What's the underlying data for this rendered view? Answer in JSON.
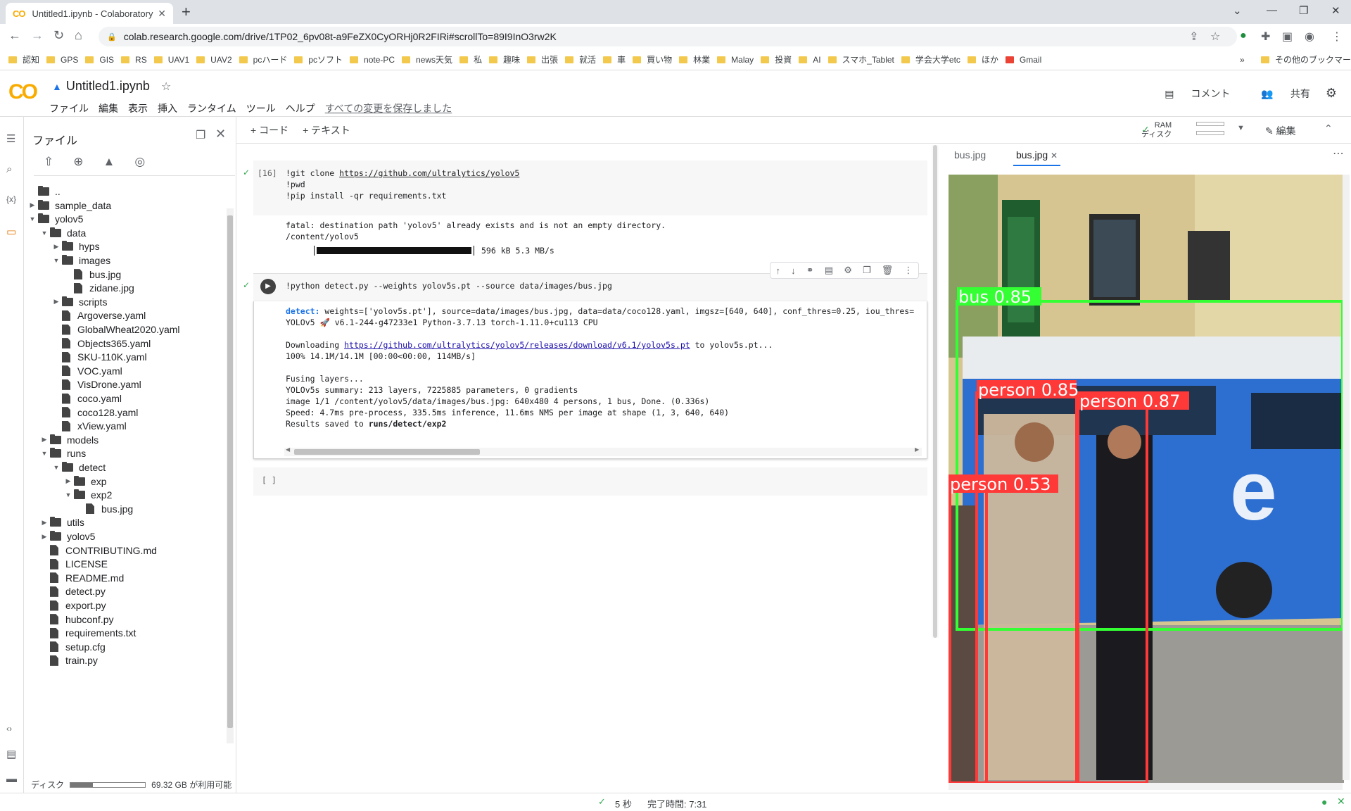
{
  "browser": {
    "tab_title": "Untitled1.ipynb - Colaboratory",
    "tab_favicon": "CO",
    "new_tab": "+",
    "url": "colab.research.google.com/drive/1TP02_6pv08t-a9FeZX0CyORHj0R2FIRi#scrollTo=89I9InO3rw2K",
    "bookmarks": [
      "認知",
      "GPS",
      "GIS",
      "RS",
      "UAV1",
      "UAV2",
      "pcハード",
      "pcソフト",
      "note-PC",
      "news天気",
      "私",
      "趣味",
      "出張",
      "就活",
      "車",
      "買い物",
      "林業",
      "Malay",
      "投資",
      "AI",
      "スマホ_Tablet",
      "学会大学etc",
      "ほか",
      "Gmail"
    ],
    "bookmarks_more": "»",
    "other_bookmarks": "その他のブックマーク"
  },
  "colab": {
    "logo": "CO",
    "title": "Untitled1.ipynb",
    "menus": [
      "ファイル",
      "編集",
      "表示",
      "挿入",
      "ランタイム",
      "ツール",
      "ヘルプ"
    ],
    "saved_status": "すべての変更を保存しました",
    "comment": "コメント",
    "share": "共有"
  },
  "files_panel": {
    "title": "ファイル",
    "tree": [
      {
        "name": "..",
        "depth": 0,
        "kind": "up",
        "arrow": ""
      },
      {
        "name": "sample_data",
        "depth": 0,
        "kind": "folder",
        "arrow": "▶"
      },
      {
        "name": "yolov5",
        "depth": 0,
        "kind": "folder",
        "arrow": "▼"
      },
      {
        "name": "data",
        "depth": 1,
        "kind": "folder",
        "arrow": "▼"
      },
      {
        "name": "hyps",
        "depth": 2,
        "kind": "folder",
        "arrow": "▶"
      },
      {
        "name": "images",
        "depth": 2,
        "kind": "folder",
        "arrow": "▼"
      },
      {
        "name": "bus.jpg",
        "depth": 3,
        "kind": "file",
        "arrow": ""
      },
      {
        "name": "zidane.jpg",
        "depth": 3,
        "kind": "file",
        "arrow": ""
      },
      {
        "name": "scripts",
        "depth": 2,
        "kind": "folder",
        "arrow": "▶"
      },
      {
        "name": "Argoverse.yaml",
        "depth": 2,
        "kind": "file",
        "arrow": ""
      },
      {
        "name": "GlobalWheat2020.yaml",
        "depth": 2,
        "kind": "file",
        "arrow": ""
      },
      {
        "name": "Objects365.yaml",
        "depth": 2,
        "kind": "file",
        "arrow": ""
      },
      {
        "name": "SKU-110K.yaml",
        "depth": 2,
        "kind": "file",
        "arrow": ""
      },
      {
        "name": "VOC.yaml",
        "depth": 2,
        "kind": "file",
        "arrow": ""
      },
      {
        "name": "VisDrone.yaml",
        "depth": 2,
        "kind": "file",
        "arrow": ""
      },
      {
        "name": "coco.yaml",
        "depth": 2,
        "kind": "file",
        "arrow": ""
      },
      {
        "name": "coco128.yaml",
        "depth": 2,
        "kind": "file",
        "arrow": ""
      },
      {
        "name": "xView.yaml",
        "depth": 2,
        "kind": "file",
        "arrow": ""
      },
      {
        "name": "models",
        "depth": 1,
        "kind": "folder",
        "arrow": "▶"
      },
      {
        "name": "runs",
        "depth": 1,
        "kind": "folder",
        "arrow": "▼"
      },
      {
        "name": "detect",
        "depth": 2,
        "kind": "folder",
        "arrow": "▼"
      },
      {
        "name": "exp",
        "depth": 3,
        "kind": "folder",
        "arrow": "▶"
      },
      {
        "name": "exp2",
        "depth": 3,
        "kind": "folder",
        "arrow": "▼"
      },
      {
        "name": "bus.jpg",
        "depth": 4,
        "kind": "file",
        "arrow": ""
      },
      {
        "name": "utils",
        "depth": 1,
        "kind": "folder",
        "arrow": "▶"
      },
      {
        "name": "yolov5",
        "depth": 1,
        "kind": "folder",
        "arrow": "▶"
      },
      {
        "name": "CONTRIBUTING.md",
        "depth": 1,
        "kind": "file",
        "arrow": ""
      },
      {
        "name": "LICENSE",
        "depth": 1,
        "kind": "file",
        "arrow": ""
      },
      {
        "name": "README.md",
        "depth": 1,
        "kind": "file",
        "arrow": ""
      },
      {
        "name": "detect.py",
        "depth": 1,
        "kind": "file",
        "arrow": ""
      },
      {
        "name": "export.py",
        "depth": 1,
        "kind": "file",
        "arrow": ""
      },
      {
        "name": "hubconf.py",
        "depth": 1,
        "kind": "file",
        "arrow": ""
      },
      {
        "name": "requirements.txt",
        "depth": 1,
        "kind": "file",
        "arrow": ""
      },
      {
        "name": "setup.cfg",
        "depth": 1,
        "kind": "file",
        "arrow": ""
      },
      {
        "name": "train.py",
        "depth": 1,
        "kind": "file",
        "arrow": ""
      }
    ],
    "disk_label": "ディスク",
    "disk_free": "69.32 GB が利用可能",
    "disk_used_fraction": 0.3
  },
  "toolbar": {
    "add_code": "+ コード",
    "add_text": "+ テキスト",
    "ram": "RAM",
    "disk": "ディスク",
    "edit": "編集"
  },
  "cells": {
    "cell1": {
      "exec_count": "[16]",
      "code_line1_prefix": "!git clone ",
      "code_line1_link": "https://github.com/ultralytics/yolov5",
      "code_line2": "!pwd",
      "code_line3": "!pip install -qr requirements.txt",
      "out_line1": "fatal: destination path 'yolov5' already exists and is not an empty directory.",
      "out_line2": "/content/yolov5",
      "progress": "596 kB 5.3 MB/s"
    },
    "cell2": {
      "code": "!python detect.py --weights yolov5s.pt --source data/images/bus.jpg",
      "detect_label": "detect: ",
      "detect_args": "weights=['yolov5s.pt'], source=data/images/bus.jpg, data=data/coco128.yaml, imgsz=[640, 640], conf_thres=0.25, iou_thres=",
      "version_prefix": "YOLOv5 ",
      "version_rest": " v6.1-244-g47233e1 Python-3.7.13 torch-1.11.0+cu113 CPU",
      "download_prefix": "Downloading ",
      "download_link": "https://github.com/ultralytics/yolov5/releases/download/v6.1/yolov5s.pt",
      "download_suffix": " to yolov5s.pt...",
      "download_progress": "100% 14.1M/14.1M [00:00<00:00, 114MB/s]",
      "fusing": "Fusing layers...",
      "summary": "YOLOv5s summary: 213 layers, 7225885 parameters, 0 gradients",
      "image_line": "image 1/1 /content/yolov5/data/images/bus.jpg: 640x480 4 persons, 1 bus, Done. (0.336s)",
      "speed": "Speed: 4.7ms pre-process, 335.5ms inference, 11.6ms NMS per image at shape (1, 3, 640, 640)",
      "results_prefix": "Results saved to ",
      "results_path": "runs/detect/exp2"
    },
    "cell3": {
      "exec_count": "[ ]"
    }
  },
  "image_viewer": {
    "tabs": [
      "bus.jpg",
      "bus.jpg"
    ],
    "detections": [
      {
        "label": "bus 0.85",
        "color": "#33ff33"
      },
      {
        "label": "person 0.85",
        "color": "#ff3838"
      },
      {
        "label": "person 0.87",
        "color": "#ff3838"
      },
      {
        "label": "person 0.53",
        "color": "#ff3838"
      }
    ]
  },
  "statusbar": {
    "elapsed": "5 秒",
    "completed": "完了時間: 7:31"
  }
}
